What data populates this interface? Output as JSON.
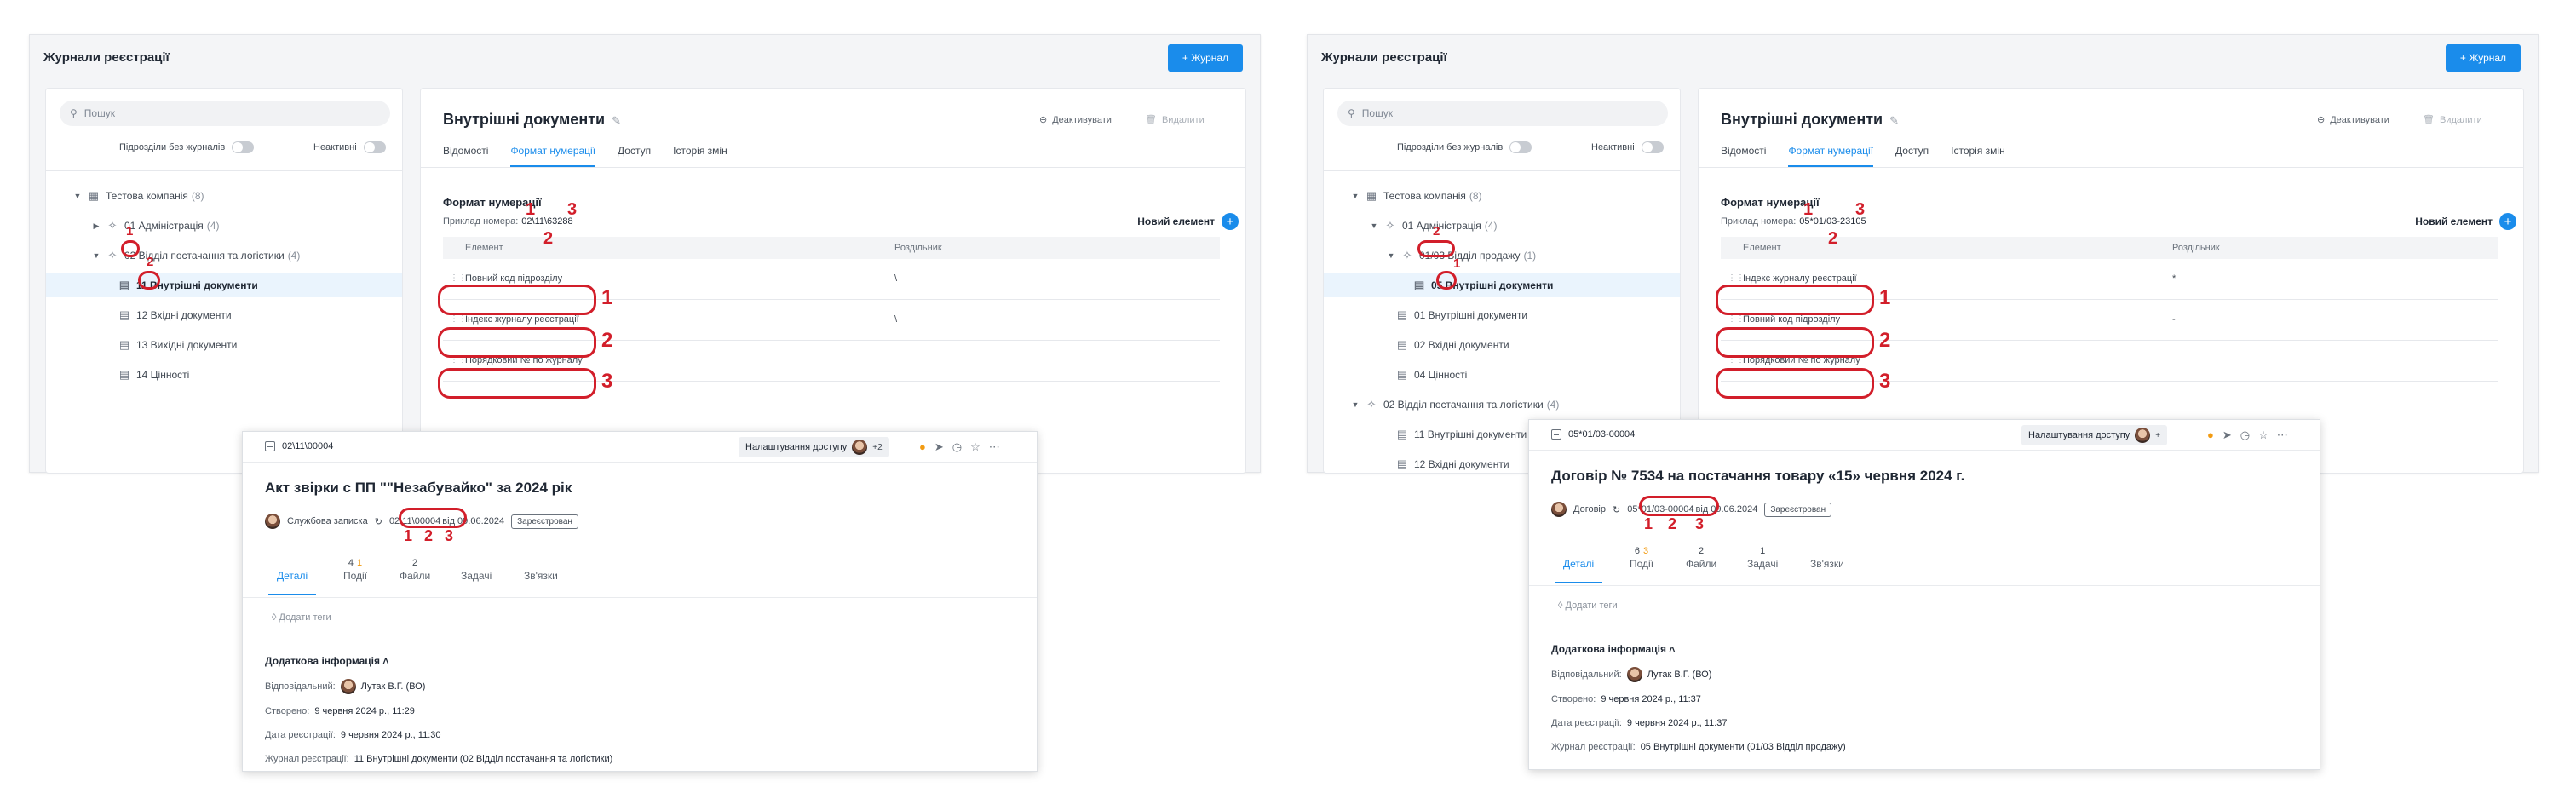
{
  "left_panel": {
    "title": "Журнали реєстрації",
    "add_button": "+ Журнал",
    "search_placeholder": "Пошук",
    "switch1": "Підрозділи без журналів",
    "switch2": "Неактивні",
    "tree": [
      {
        "label": "Тестова компанія",
        "count": "(8)"
      },
      {
        "label": "01 Адміністрація",
        "count": "(4)"
      },
      {
        "label": "02 Відділ постачання та логістики",
        "count": "(4)"
      },
      {
        "label": "11 Внутрішні документи",
        "count": ""
      },
      {
        "label": "12 Вхідні документи",
        "count": ""
      },
      {
        "label": "13 Вихідні документи",
        "count": ""
      },
      {
        "label": "14 Цінності",
        "count": ""
      }
    ],
    "journal_title": "Внутрішні документи",
    "deactivate": "Деактивувати",
    "delete": "Видалити",
    "tabs": [
      "Відомості",
      "Формат нумерації",
      "Доступ",
      "Історія змін"
    ],
    "format_title": "Формат нумерації",
    "example_label": "Приклад номера:",
    "example_value": "02\\11\\63288",
    "new_element": "Новий елемент",
    "col_element": "Елемент",
    "col_separator": "Роздільник",
    "rows": [
      {
        "element": "Повний код підрозділу",
        "separator": "\\"
      },
      {
        "element": "Індекс журналу реєстрації",
        "separator": "\\"
      },
      {
        "element": "Порядковий № по журналу",
        "separator": ""
      }
    ]
  },
  "right_panel": {
    "title": "Журнали реєстрації",
    "add_button": "+ Журнал",
    "search_placeholder": "Пошук",
    "switch1": "Підрозділи без журналів",
    "switch2": "Неактивні",
    "tree": [
      {
        "label": "Тестова компанія",
        "count": "(8)"
      },
      {
        "label": "01 Адміністрація",
        "count": "(4)"
      },
      {
        "label": "01/03 Відділ продажу",
        "count": "(1)"
      },
      {
        "label": "05 Внутрішні документи",
        "count": ""
      },
      {
        "label": "01 Внутрішні документи",
        "count": ""
      },
      {
        "label": "02 Вхідні документи",
        "count": ""
      },
      {
        "label": "04 Цінності",
        "count": ""
      },
      {
        "label": "02 Відділ постачання та логістики",
        "count": "(4)"
      },
      {
        "label": "11 Внутрішні документи",
        "count": ""
      },
      {
        "label": "12 Вхідні документи",
        "count": ""
      }
    ],
    "journal_title": "Внутрішні документи",
    "deactivate": "Деактивувати",
    "delete": "Видалити",
    "tabs": [
      "Відомості",
      "Формат нумерації",
      "Доступ",
      "Історія змін"
    ],
    "format_title": "Формат нумерації",
    "example_label": "Приклад номера:",
    "example_value": "05*01/03-23105",
    "new_element": "Новий елемент",
    "col_element": "Елемент",
    "col_separator": "Роздільник",
    "rows": [
      {
        "element": "Індекс журналу реєстрації",
        "separator": "*"
      },
      {
        "element": "Повний код підрозділу",
        "separator": "-"
      },
      {
        "element": "Порядковий № по журналу",
        "separator": ""
      }
    ]
  },
  "left_card": {
    "doc_number": "02\\11\\00004",
    "access": "Налаштування доступу",
    "access_more": "+2",
    "title": "Акт звірки с ПП \"\"Незабувайко\" за 2024 рік",
    "doc_type": "Службова записка",
    "reg_number": "02\\11\\00004",
    "reg_date": "від 09.06.2024",
    "status": "Зареєстрован",
    "tabs": [
      {
        "label": "Деталі",
        "n": "",
        "n2": ""
      },
      {
        "label": "Події",
        "n": "4",
        "n2": "1"
      },
      {
        "label": "Файли",
        "n": "2",
        "n2": ""
      },
      {
        "label": "Задачі",
        "n": "",
        "n2": ""
      },
      {
        "label": "Зв'язки",
        "n": "",
        "n2": ""
      }
    ],
    "add_tags": "Додати теги",
    "extra": "Додаткова інформація",
    "responsible_label": "Відповідальний:",
    "responsible": "Лутак В.Г. (ВО)",
    "created_label": "Створено:",
    "created": "9 червня 2024 р., 11:29",
    "reg_date_label": "Дата реєстрації:",
    "reg_date_value": "9 червня 2024 р., 11:30",
    "journal_label": "Журнал реєстрації:",
    "journal": "11 Внутрішні документи (02 Відділ постачання та логістики)"
  },
  "right_card": {
    "doc_number": "05*01/03-00004",
    "access": "Налаштування доступу",
    "access_more": "+",
    "title": "Договір № 7534 на постачання товару «15» червня 2024 г.",
    "doc_type": "Договір",
    "reg_number": "05*01/03-00004",
    "reg_date": "від 09.06.2024",
    "status": "Зареєстрован",
    "tabs": [
      {
        "label": "Деталі",
        "n": "",
        "n2": ""
      },
      {
        "label": "Події",
        "n": "6",
        "n2": "3"
      },
      {
        "label": "Файли",
        "n": "2",
        "n2": ""
      },
      {
        "label": "Задачі",
        "n": "1",
        "n2": ""
      },
      {
        "label": "Зв'язки",
        "n": "",
        "n2": ""
      }
    ],
    "add_tags": "Додати теги",
    "extra": "Додаткова інформація",
    "responsible_label": "Відповідальний:",
    "responsible": "Лутак В.Г. (ВО)",
    "created_label": "Створено:",
    "created": "9 червня 2024 р., 11:37",
    "reg_date_label": "Дата реєстрації:",
    "reg_date_value": "9 червня 2024 р., 11:37",
    "journal_label": "Журнал реєстрації:",
    "journal": "05 Внутрішні документи (01/03 Відділ продажу)"
  },
  "markers": {
    "one": "1",
    "two": "2",
    "three": "3"
  },
  "colors": {
    "accent": "#1a8ceb",
    "annotation": "#d21e2a",
    "warn": "#f29b12"
  }
}
